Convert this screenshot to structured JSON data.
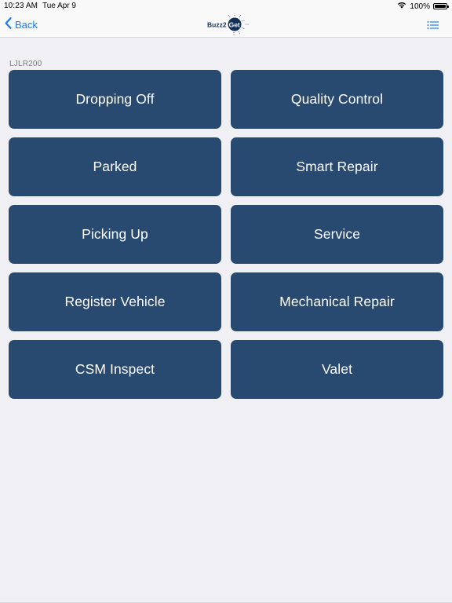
{
  "status_bar": {
    "time": "10:23 AM",
    "date": "Tue Apr 9",
    "battery_text": "100%",
    "battery_level": 1.0
  },
  "nav": {
    "back_label": "Back",
    "logo_text_left": "Buzz2",
    "logo_text_right": "Get"
  },
  "section": {
    "label": "LJLR200"
  },
  "tiles": [
    {
      "label": "Dropping Off"
    },
    {
      "label": "Quality Control"
    },
    {
      "label": "Parked"
    },
    {
      "label": "Smart Repair"
    },
    {
      "label": "Picking Up"
    },
    {
      "label": "Service"
    },
    {
      "label": "Register Vehicle"
    },
    {
      "label": "Mechanical Repair"
    },
    {
      "label": "CSM Inspect"
    },
    {
      "label": "Valet"
    }
  ],
  "colors": {
    "tile_bg": "#294a70",
    "accent": "#1a7cf2",
    "background": "#efeff4"
  }
}
